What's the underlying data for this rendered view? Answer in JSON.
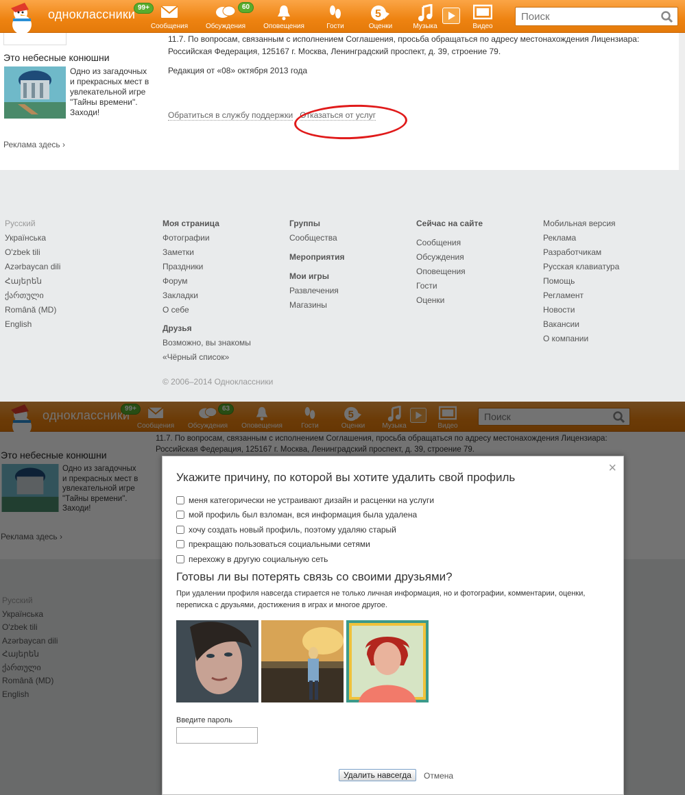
{
  "header": {
    "brand": "одноклассники",
    "badge_messages": "99+",
    "badge_discussions_top": "60",
    "badge_discussions_bottom": "63",
    "nav": [
      {
        "label": "Сообщения"
      },
      {
        "label": "Обсуждения"
      },
      {
        "label": "Оповещения"
      },
      {
        "label": "Гости"
      },
      {
        "label": "Оценки"
      },
      {
        "label": "Музыка"
      },
      {
        "label": "Видео"
      }
    ],
    "search_placeholder": "Поиск"
  },
  "sidebar": {
    "ad_title": "Это небесные конюшни",
    "ad_text": "Одно из загадочных и прекрасных мест в увлекательной игре \"Тайны времени\". Заходи!",
    "ad_more": "Реклама здесь ›"
  },
  "main": {
    "para_1": "11.7. По вопросам, связанным с исполнением Соглашения, просьба обращаться по адресу местонахождения Лицензиара: Российская Федерация, 125167 г. Москва, Ленинградский проспект, д. 39, строение 79.",
    "para_2": "Редакция от «08» октября 2013 года",
    "support_link": "Обратиться в службу поддержки",
    "refuse_link": "Отказаться от услуг"
  },
  "footer": {
    "languages": [
      "Русский",
      "Українська",
      "O'zbek tili",
      "Azərbaycan dili",
      "Հայերեն",
      "ქართული",
      "Română (MD)",
      "English"
    ],
    "col_my_page": {
      "heading": "Моя страница",
      "items": [
        "Фотографии",
        "Заметки",
        "Праздники",
        "Форум",
        "Закладки",
        "О себе"
      ],
      "heading_2": "Друзья",
      "items_2": [
        "Возможно, вы знакомы",
        "«Чёрный список»"
      ]
    },
    "col_groups": {
      "heading": "Группы",
      "items": [
        "Сообщества"
      ],
      "heading_2": "Мероприятия",
      "heading_3": "Мои игры",
      "items_3": [
        "Развлечения",
        "Магазины"
      ]
    },
    "col_now": {
      "heading": "Сейчас на сайте",
      "items": [
        "Сообщения",
        "Обсуждения",
        "Оповещения",
        "Гости",
        "Оценки"
      ]
    },
    "col_misc": {
      "items": [
        "Мобильная версия",
        "Реклама",
        "Разработчикам",
        "Русская клавиатура",
        "Помощь",
        "Регламент",
        "Новости",
        "Вакансии",
        "О компании"
      ]
    },
    "copyright": "© 2006–2014 Одноклассники"
  },
  "modal": {
    "title": "Укажите причину, по которой вы хотите удалить свой профиль",
    "reasons": [
      "меня категорически не устраивают дизайн и расценки на услуги",
      "мой профиль был взломан, вся информация была удалена",
      "хочу создать новый профиль, поэтому удаляю старый",
      "прекращаю пользоваться социальными сетями",
      "перехожу в другую социальную сеть"
    ],
    "title_2": "Готовы ли вы потерять связь со своими друзьями?",
    "warning": "При удалении профиля навсегда стирается не только личная информация, но и фотографии, комментарии, оценки, переписка с друзьями, достижения в играх и многое другое.",
    "password_label": "Введите пароль",
    "delete_button": "Удалить навсегда",
    "cancel_link": "Отмена",
    "close_glyph": "×"
  },
  "colors": {
    "header_orange": "#ee8311",
    "badge_green": "#5aac2e",
    "highlight_red": "#e01a1a"
  }
}
